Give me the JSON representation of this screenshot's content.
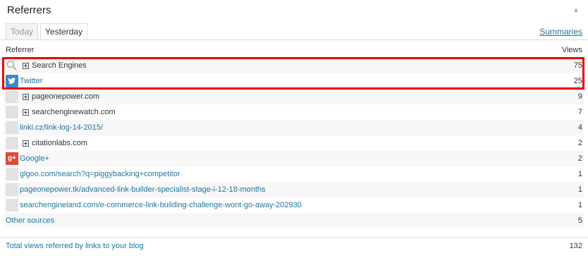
{
  "widget": {
    "title": "Referrers",
    "collapse_glyph": "▲"
  },
  "tabs": [
    {
      "label": "Today"
    },
    {
      "label": "Yesterday",
      "active": true
    }
  ],
  "summaries_link": "Summaries",
  "columns": {
    "referrer": "Referrer",
    "views": "Views"
  },
  "rows": [
    {
      "icon": "search-icon",
      "expandable": true,
      "label": "Search Engines",
      "link": false,
      "views": "75"
    },
    {
      "icon": "twitter-icon",
      "expandable": false,
      "label": "Twitter",
      "link": true,
      "views": "25"
    },
    {
      "icon": "blank-icon",
      "expandable": true,
      "label": "pageonepower.com",
      "link": false,
      "views": "9"
    },
    {
      "icon": "blank-icon",
      "expandable": true,
      "label": "searchenginewatch.com",
      "link": false,
      "views": "7"
    },
    {
      "icon": "blank-icon",
      "expandable": false,
      "label": "linki.cz/link-log-14-2015/",
      "link": true,
      "views": "4"
    },
    {
      "icon": "blank-icon",
      "expandable": true,
      "label": "citationlabs.com",
      "link": false,
      "views": "2"
    },
    {
      "icon": "google-plus-icon",
      "expandable": false,
      "label": "Google+",
      "link": true,
      "views": "2"
    },
    {
      "icon": "blank-icon",
      "expandable": false,
      "label": "glgoo.com/search?q=piggybacking+competitor",
      "link": true,
      "views": "1"
    },
    {
      "icon": "blank-icon",
      "expandable": false,
      "label": "pageonepower.tk/advanced-link-builder-specialist-stage-i-12-18-months",
      "link": true,
      "views": "1"
    },
    {
      "icon": "blank-icon",
      "expandable": false,
      "label": "searchengineland.com/e-commerce-link-building-challenge-wont-go-away-202930",
      "link": true,
      "views": "1"
    },
    {
      "icon": "none",
      "expandable": false,
      "label": "Other sources",
      "link": true,
      "views": "5"
    }
  ],
  "total": {
    "label": "Total views referred by links to your blog",
    "views": "132"
  },
  "colors": {
    "link": "#21759b",
    "highlight": "#e00000",
    "twitter": "#3a89c9",
    "google_plus": "#dd4b39"
  }
}
